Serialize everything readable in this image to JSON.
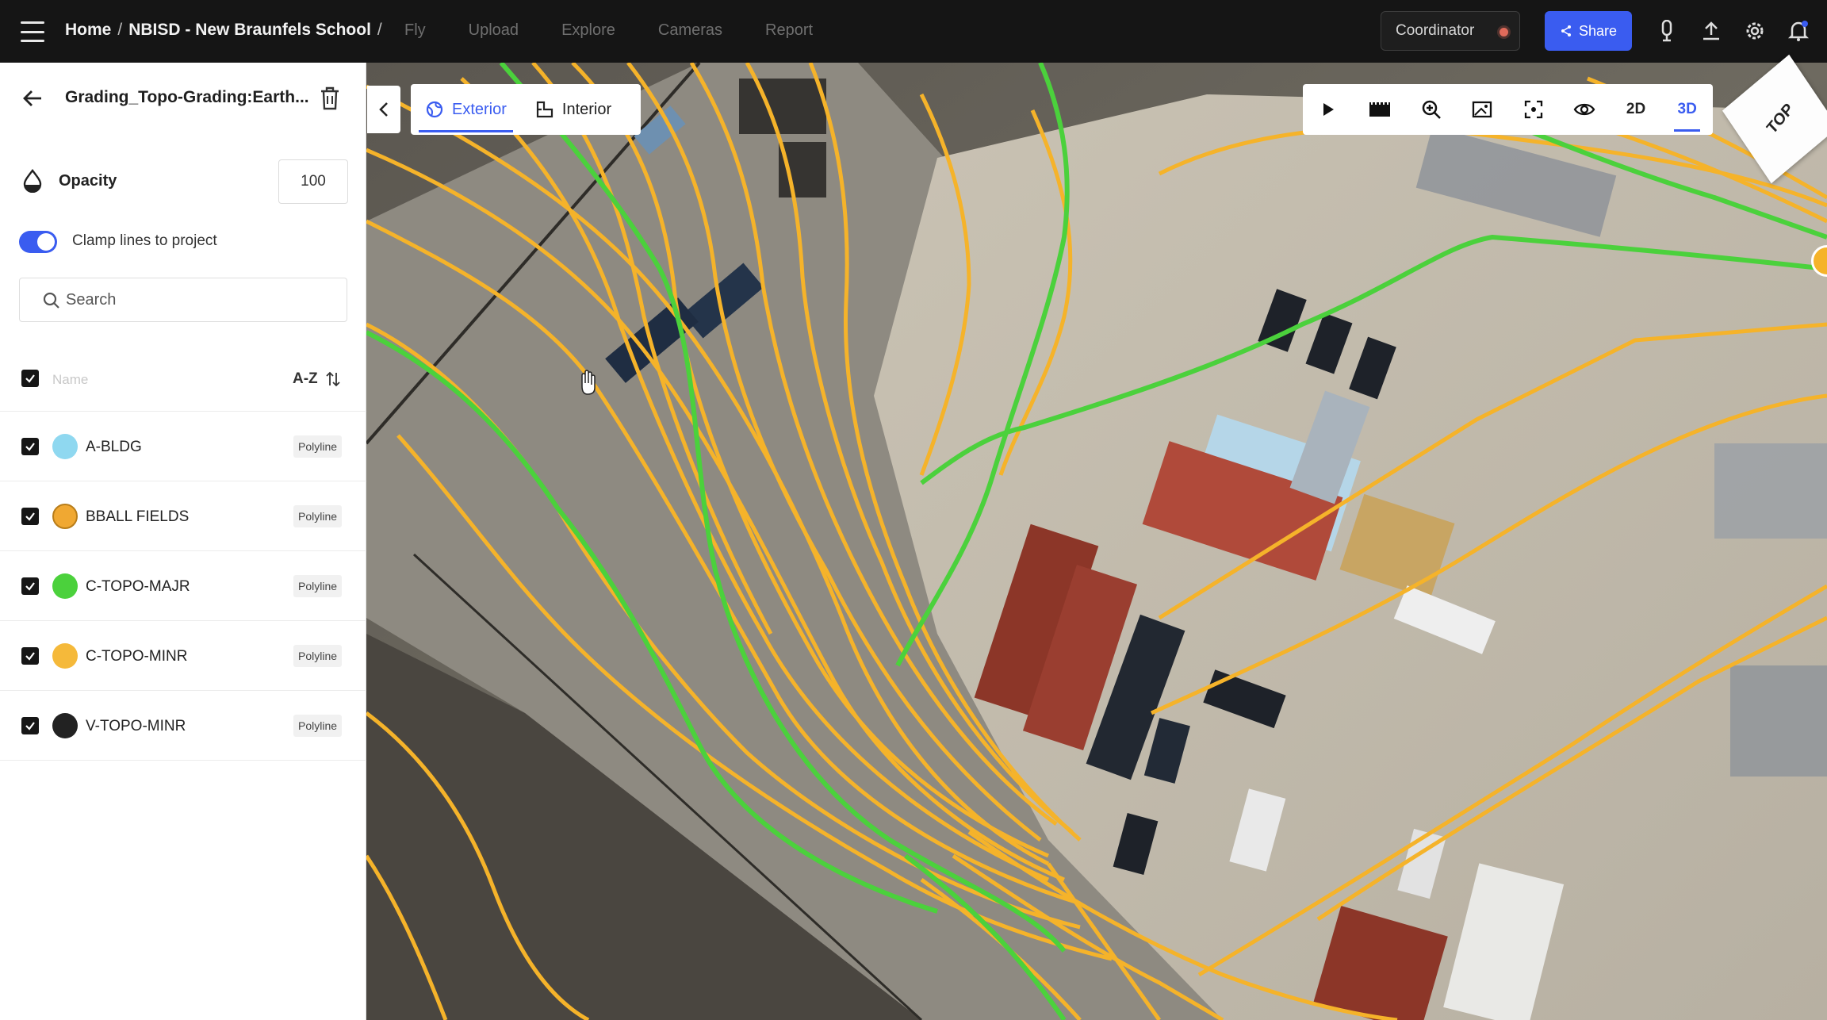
{
  "topbar": {
    "breadcrumb": [
      "Home",
      "NBISD - New Braunfels School"
    ],
    "nav": [
      "Fly",
      "Upload",
      "Explore",
      "Cameras",
      "Report"
    ],
    "coordinator_label": "Coordinator",
    "share_label": "Share",
    "icons": [
      "menu-icon",
      "bell-icon",
      "upload-icon",
      "gear-icon",
      "notification-icon"
    ]
  },
  "sidebar": {
    "layer_name": "Grading_Topo-Grading:Earth...",
    "opacity_label": "Opacity",
    "opacity_value": "100",
    "clamp_label": "Clamp lines to project",
    "clamp_enabled": true,
    "search_placeholder": "Search",
    "name_header": "Name",
    "sort_label": "A-Z",
    "layers": [
      {
        "name": "A-BLDG",
        "type": "Polyline",
        "color": "#8fd8f0"
      },
      {
        "name": "BBALL FIELDS",
        "type": "Polyline",
        "color": "#f0a832"
      },
      {
        "name": "C-TOPO-MAJR",
        "type": "Polyline",
        "color": "#4bd13c"
      },
      {
        "name": "C-TOPO-MINR",
        "type": "Polyline",
        "color": "#f5b93a"
      },
      {
        "name": "V-TOPO-MINR",
        "type": "Polyline",
        "color": "#222222"
      }
    ]
  },
  "map": {
    "view_tabs": [
      {
        "label": "Exterior",
        "active": true
      },
      {
        "label": "Interior",
        "active": false
      }
    ],
    "toolbar": [
      "play-icon",
      "film-icon",
      "zoom-icon",
      "image-icon",
      "frame-icon",
      "eye-icon",
      "2D",
      "3D"
    ],
    "active_mode": "3D",
    "cube_label": "TOP",
    "colors": {
      "major": "#4bd13c",
      "minor": "#f5b32a",
      "accent": "#3a5cf0"
    }
  }
}
